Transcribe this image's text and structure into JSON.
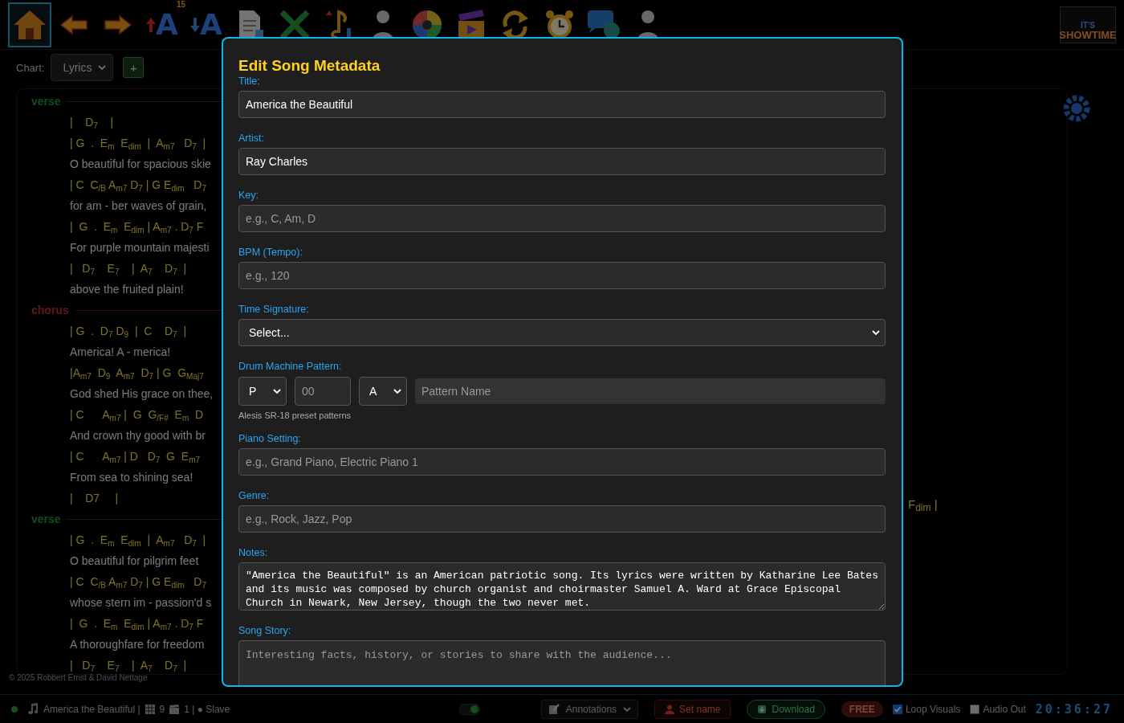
{
  "toolbar": {
    "items": [
      {
        "kind": "home",
        "selected": true
      },
      {
        "kind": "arrow-left",
        "selected": false
      },
      {
        "kind": "arrow-right",
        "selected": false
      },
      {
        "kind": "font-up",
        "glyph": "A",
        "badge": "15",
        "selected": false
      },
      {
        "kind": "font-down",
        "glyph": "A",
        "selected": false
      },
      {
        "kind": "document",
        "selected": false
      },
      {
        "kind": "expand",
        "selected": false
      },
      {
        "kind": "music-note",
        "selected": false
      },
      {
        "kind": "figure",
        "selected": false
      },
      {
        "kind": "color-wheel",
        "selected": false
      },
      {
        "kind": "clapper",
        "selected": false
      },
      {
        "kind": "loop",
        "selected": false
      },
      {
        "kind": "alarm-clock",
        "selected": false
      },
      {
        "kind": "chat",
        "selected": false
      },
      {
        "kind": "figure",
        "selected": false
      }
    ],
    "logo": {
      "line1": "IT'S",
      "line2": "SHOWTIME"
    }
  },
  "chart_selector": {
    "label": "Chart:",
    "value": "Lyrics",
    "add": "+"
  },
  "lyrics": {
    "sections": [
      {
        "label": "verse",
        "kind": "verse",
        "lines": [
          {
            "kind": "chords",
            "text": "|    D$_{7}$    |"
          },
          {
            "kind": "chords",
            "text": "| G  .  E$_{m}$  E$_{dim}$  |  A$_{m7}$   D$_{7}$  |"
          },
          {
            "kind": "lyric",
            "text": "O beautiful for spacious skie"
          },
          {
            "kind": "chords",
            "text": "| C  C$_{/B}$ A$_{m7}$ D$_{7}$ | G E$_{dim}$   D$_{7}$"
          },
          {
            "kind": "lyric",
            "text": "for am - ber waves of grain,"
          },
          {
            "kind": "chords",
            "text": "|  G  .  E$_{m}$  E$_{dim}$ | A$_{m7}$ . D$_{7}$ F"
          },
          {
            "kind": "lyric",
            "text": "For purple mountain majesti"
          },
          {
            "kind": "chords",
            "text": "|   D$_{7}$    E$_{7}$    |  A$_{7}$    D$_{7}$  |"
          },
          {
            "kind": "lyric",
            "text": "above the fruited plain!"
          }
        ]
      },
      {
        "label": "chorus",
        "kind": "chorus",
        "lines": [
          {
            "kind": "chords",
            "text": "| G  .  D$_{7}$ D$_{9}$  |  C    D$_{7}$  |"
          },
          {
            "kind": "lyric",
            "text": "America! A - merica!"
          },
          {
            "kind": "chords",
            "text": "|A$_{m7}$  D$_{9}$  A$_{m7}$  D$_{7}$ | G  G$_{Maj7}$"
          },
          {
            "kind": "lyric",
            "text": "God shed His grace on thee,"
          },
          {
            "kind": "chords",
            "text": "| C      A$_{m7}$ |  G  G$_{/F#}$  E$_{m}$  D"
          },
          {
            "kind": "lyric",
            "text": "And crown thy good with br"
          },
          {
            "kind": "chords",
            "text": "| C      A$_{m7}$ | D   D$_{7}$  G  E$_{m7}$"
          },
          {
            "kind": "lyric",
            "text": "From sea to shining sea!"
          },
          {
            "kind": "chords",
            "text": "|    D7     |"
          }
        ]
      },
      {
        "label": "verse",
        "kind": "verse",
        "lines": [
          {
            "kind": "chords",
            "text": "| G  .  E$_{m}$  E$_{dim}$  |  A$_{m7}$   D$_{7}$  |"
          },
          {
            "kind": "lyric",
            "text": "O beautiful for pilgrim feet"
          },
          {
            "kind": "chords",
            "text": "| C  C$_{/B}$ A$_{m7}$ D$_{7}$ | G E$_{dim}$   D$_{7}$"
          },
          {
            "kind": "lyric",
            "text": "whose stern im - passion'd s"
          },
          {
            "kind": "chords",
            "text": "|  G  .  E$_{m}$  E$_{dim}$ | A$_{m7}$ . D$_{7}$ F"
          },
          {
            "kind": "lyric",
            "text": "A thoroughfare for freedom"
          },
          {
            "kind": "chords",
            "text": "|   D$_{7}$    E$_{7}$    |  A$_{7}$    D$_{7}$  |"
          }
        ]
      }
    ],
    "overflow_chord": "F$_{dim}$ |",
    "copyright": "© 2025 Robbert Ernst & David Nettage"
  },
  "status_bar": {
    "song": "America the Beautiful |",
    "pages": "9",
    "scenes": "1 | ● Slave",
    "toggle_on": true,
    "annotations": "Annotations",
    "set_name": "Set name",
    "download": "Download",
    "plan": "FREE",
    "checkboxes": [
      {
        "label": "Loop Visuals",
        "checked": true
      },
      {
        "label": "Audio Out",
        "checked": false
      }
    ],
    "clock": "20:36:27"
  },
  "dialog": {
    "title": "Edit Song Metadata",
    "fields": [
      {
        "kind": "text",
        "label": "Title:",
        "value": "America the Beautiful"
      },
      {
        "kind": "text",
        "label": "Artist:",
        "value": "Ray Charles"
      },
      {
        "kind": "text",
        "label": "Key:",
        "placeholder": "e.g., C, Am, D"
      },
      {
        "kind": "text",
        "label": "BPM (Tempo):",
        "placeholder": "e.g., 120"
      },
      {
        "kind": "select",
        "label": "Time Signature:",
        "value": "Select..."
      },
      {
        "kind": "drum",
        "label": "Drum Machine Pattern:",
        "bank": "P",
        "number_placeholder": "00",
        "variation": "A",
        "name_placeholder": "Pattern Name",
        "hint": "Alesis SR-18 preset patterns"
      },
      {
        "kind": "text",
        "label": "Piano Setting:",
        "placeholder": "e.g., Grand Piano, Electric Piano 1"
      },
      {
        "kind": "text",
        "label": "Genre:",
        "placeholder": "e.g., Rock, Jazz, Pop"
      },
      {
        "kind": "textarea",
        "label": "Notes:",
        "value": "\"America the Beautiful\" is an American patriotic song. Its lyrics were written by Katharine Lee Bates and its music was composed by church organist and choirmaster Samuel A. Ward at Grace Episcopal Church in Newark, New Jersey, though the two never met."
      },
      {
        "kind": "textarea",
        "label": "Song Story:",
        "placeholder": "Interesting facts, history, or stories to share with the audience..."
      }
    ]
  }
}
